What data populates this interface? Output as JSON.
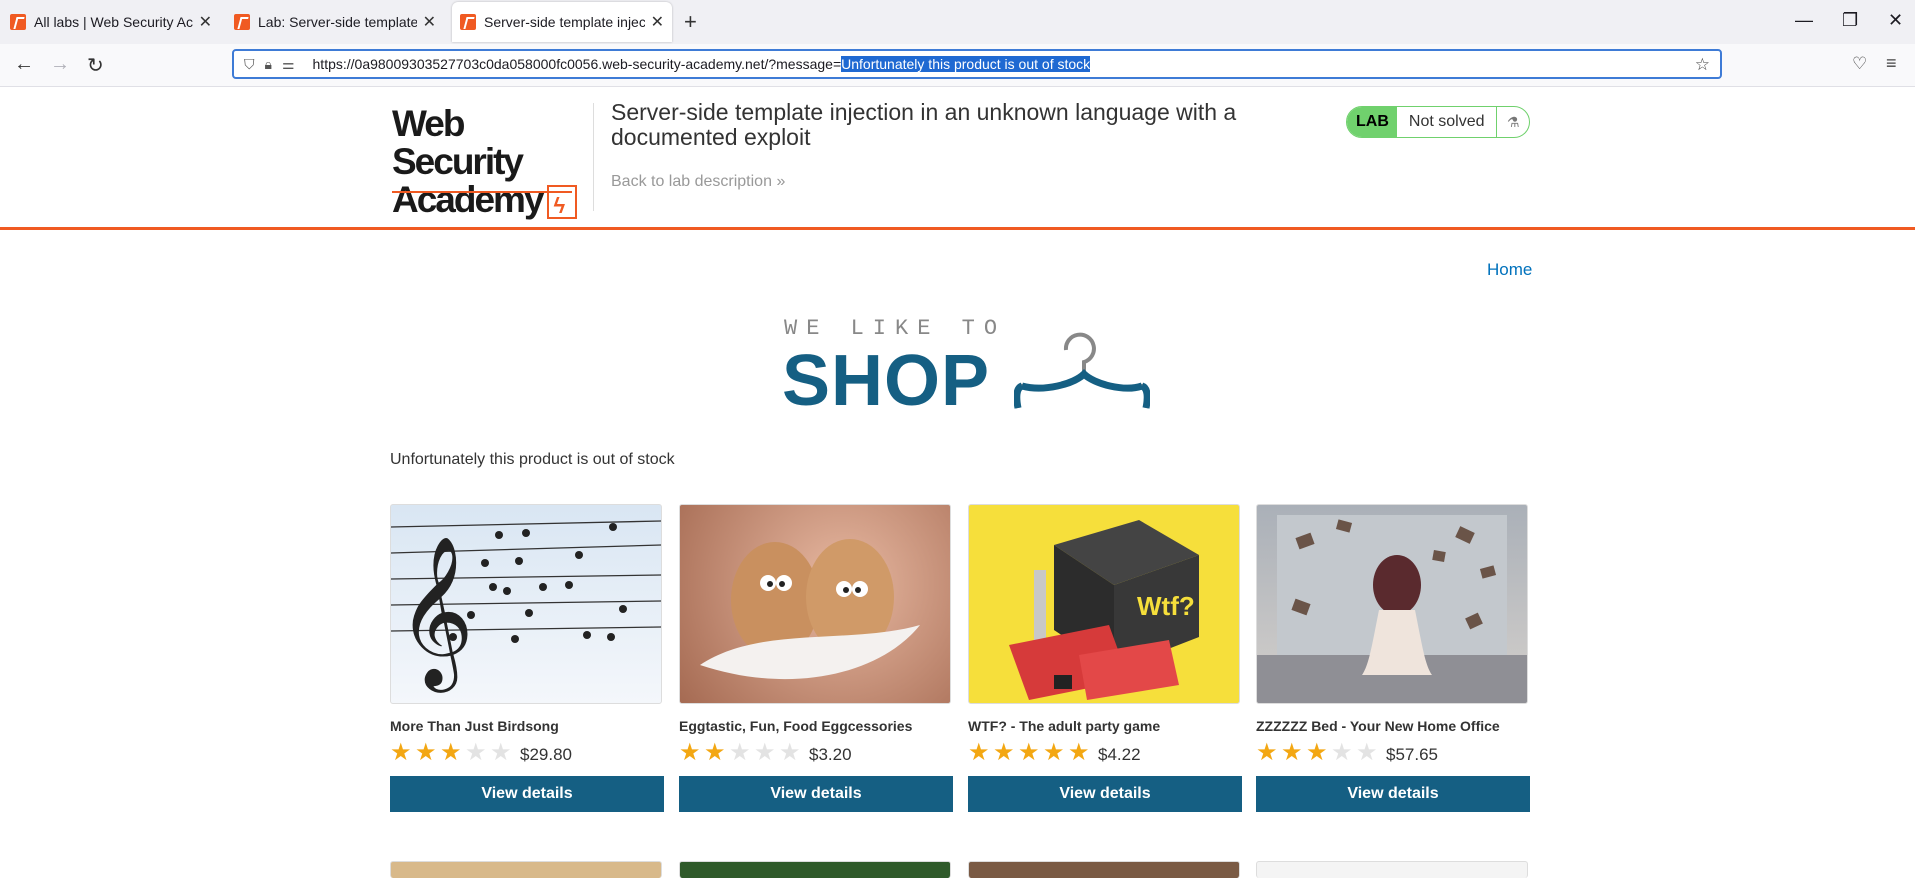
{
  "browser": {
    "tabs": [
      {
        "title": "All labs | Web Security Academy"
      },
      {
        "title": "Lab: Server-side template injection in an unknown language with a documented exploit"
      },
      {
        "title": "Server-side template injection in an unknown language with a documented exploit"
      }
    ],
    "new_tab_label": "+",
    "url_prefix": "https://0a98009303527703c0da058000fc0056.web-security-academy.net/?message=",
    "url_selected": "Unfortunately this product is out of stock"
  },
  "lab": {
    "logo_line1": "Web Security",
    "logo_line2": "Academy",
    "title": "Server-side template injection in an unknown language with a documented exploit",
    "back_link": "Back to lab description",
    "badge_label": "LAB",
    "status": "Not solved"
  },
  "shop": {
    "home_link": "Home",
    "banner_top": "WE LIKE TO",
    "banner_main": "SHOP",
    "message": "Unfortunately this product is out of stock",
    "products": [
      {
        "name": "More Than Just Birdsong",
        "rating": 3,
        "price": "$29.80",
        "button": "View details"
      },
      {
        "name": "Eggtastic, Fun, Food Eggcessories",
        "rating": 2,
        "price": "$3.20",
        "button": "View details"
      },
      {
        "name": "WTF? - The adult party game",
        "rating": 5,
        "price": "$4.22",
        "button": "View details"
      },
      {
        "name": "ZZZZZZ Bed - Your New Home Office",
        "rating": 3,
        "price": "$57.65",
        "button": "View details"
      }
    ]
  },
  "colors": {
    "accent": "#f05a22",
    "button": "#155f83",
    "star": "#f3a712",
    "link": "#0071bc",
    "lab_badge": "#70d16d"
  }
}
